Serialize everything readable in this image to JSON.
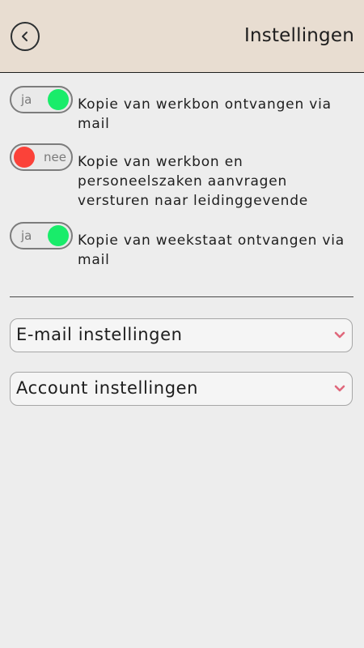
{
  "header": {
    "title": "Instellingen",
    "back_icon": "chevron-left-icon"
  },
  "settings": [
    {
      "state": "on",
      "toggle_label": "ja",
      "label": "Kopie van werkbon ontvangen via mail"
    },
    {
      "state": "off",
      "toggle_label": "nee",
      "label": "Kopie van werkbon en personeelszaken aanvragen versturen naar leidinggevende"
    },
    {
      "state": "on",
      "toggle_label": "ja",
      "label": "Kopie van weekstaat ontvangen via mail"
    }
  ],
  "dropdowns": [
    {
      "label": "E-mail instellingen",
      "icon": "chevron-down-icon"
    },
    {
      "label": "Account instellingen",
      "icon": "chevron-down-icon"
    }
  ],
  "colors": {
    "header_bg": "#e8ddd1",
    "toggle_on": "#19ec6a",
    "toggle_off": "#fb4239",
    "chevron": "#e0687c",
    "page_bg": "#ededed"
  }
}
